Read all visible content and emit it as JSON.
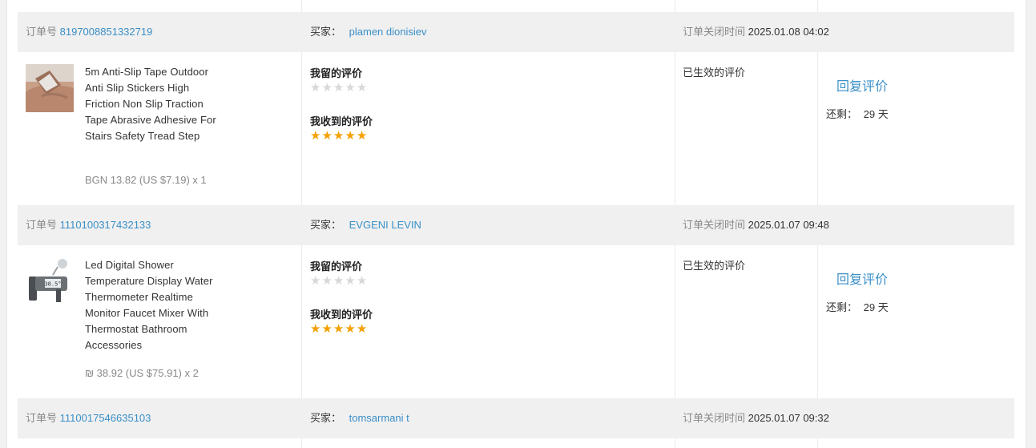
{
  "labels": {
    "order_no": "订单号",
    "buyer": "买家：",
    "close_time": "订单关闭时间",
    "my_review": "我留的评价",
    "received_review": "我收到的评价",
    "status": "已生效的评价",
    "reply": "回复评价",
    "remaining": "还剩：",
    "days": "29 天"
  },
  "colors": {
    "link": "#3a8fc7",
    "star": "#f5a000",
    "star_empty": "#d8d8d8",
    "header_bg": "#f0f0f0"
  },
  "orders": [
    {
      "order_id": "8197008851332719",
      "buyer": "plamen dionisiev",
      "close_time": "2025.01.08 04:02",
      "product_name": "5m Anti-Slip Tape Outdoor Anti Slip Stickers High Friction Non Slip Traction Tape Abrasive Adhesive For Stairs Safety Tread Step",
      "price": "BGN 13.82 (US $7.19) x 1",
      "my_rating": 0,
      "received_rating": 5,
      "thumb_icon": "anti-slip-tape-icon"
    },
    {
      "order_id": "1110100317432133",
      "buyer": "EVGENI LEVIN",
      "close_time": "2025.01.07 09:48",
      "product_name": "Led Digital Shower Temperature Display Water Thermometer Realtime Monitor Faucet Mixer With Thermostat Bathroom Accessories",
      "price": "₪ 38.92 (US $75.91) x 2",
      "my_rating": 0,
      "received_rating": 5,
      "thumb_icon": "shower-thermometer-icon",
      "thumb_display": "38.5°"
    },
    {
      "order_id": "1110017546635103",
      "buyer": "tomsarmani t",
      "close_time": "2025.01.07 09:32"
    }
  ]
}
